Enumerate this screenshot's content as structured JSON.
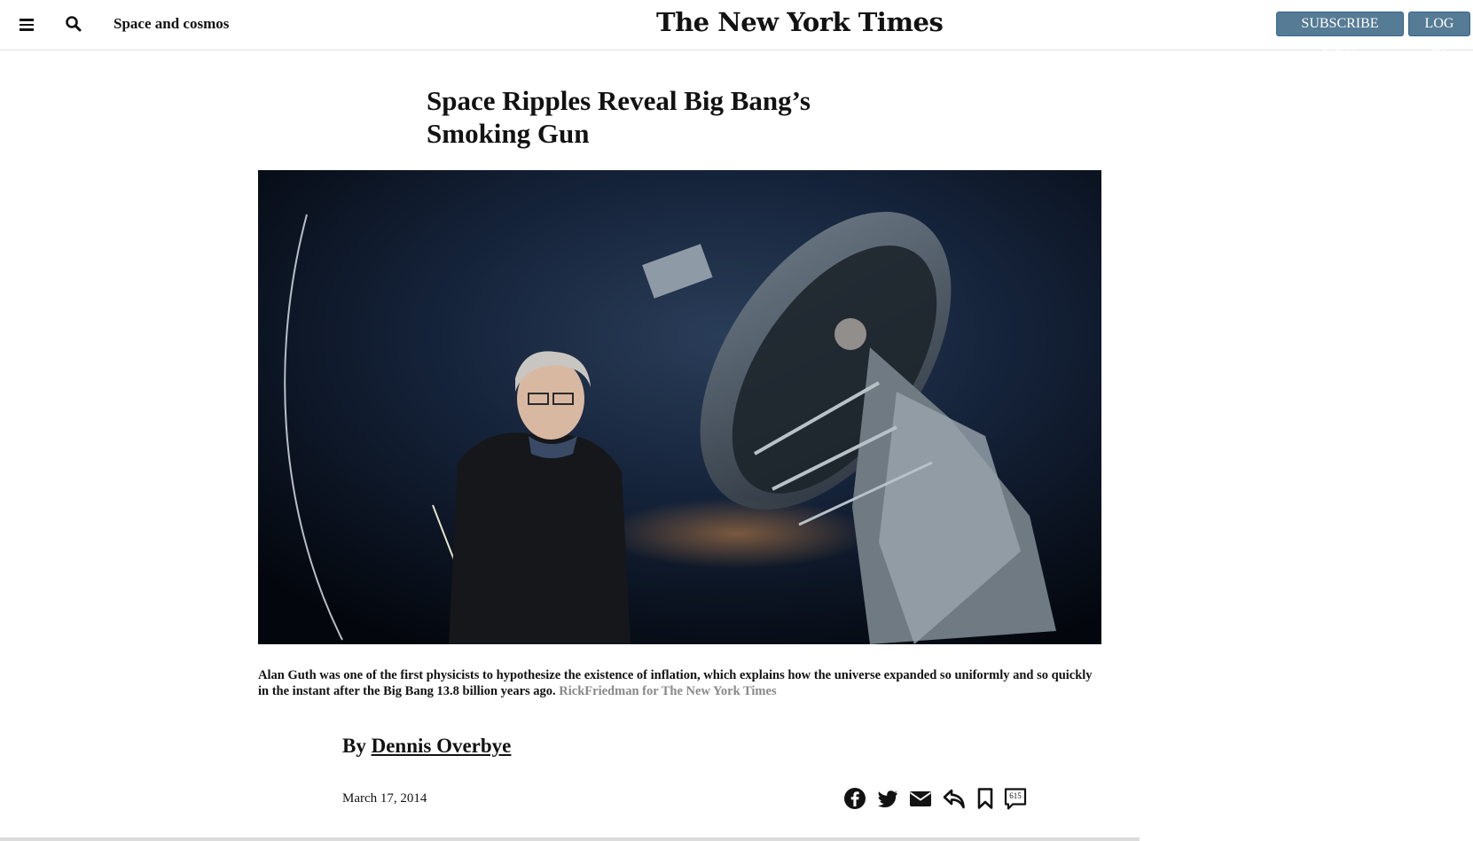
{
  "header": {
    "section_label": "Space and cosmos",
    "logo": "The New York Times",
    "subscribe_label": "SUBSCRIBE NOW",
    "login_label": "LOG IN",
    "menu_icon": "hamburger-menu-icon",
    "search_icon": "search-icon"
  },
  "article": {
    "headline_line1": "Space Ripples Reveal Big Bang’s",
    "headline_line2": "Smoking Gun",
    "caption_text": "Alan Guth was one of the first physicists to hypothesize the existence of inflation, which explains how the universe expanded so uniformly and so quickly in the instant after the Big Bang 13.8 billion years ago.",
    "caption_credit": "RickFriedman for The New York Times",
    "byline_prefix": "By",
    "author": "Dennis Overbye",
    "date": "March 17, 2014"
  },
  "share": {
    "icons": [
      "facebook-icon",
      "twitter-icon",
      "email-icon",
      "share-icon",
      "bookmark-icon",
      "comments-icon"
    ],
    "comment_count": "615"
  },
  "colors": {
    "button_bg": "#567b95",
    "text": "#121212",
    "credit": "#888888"
  }
}
